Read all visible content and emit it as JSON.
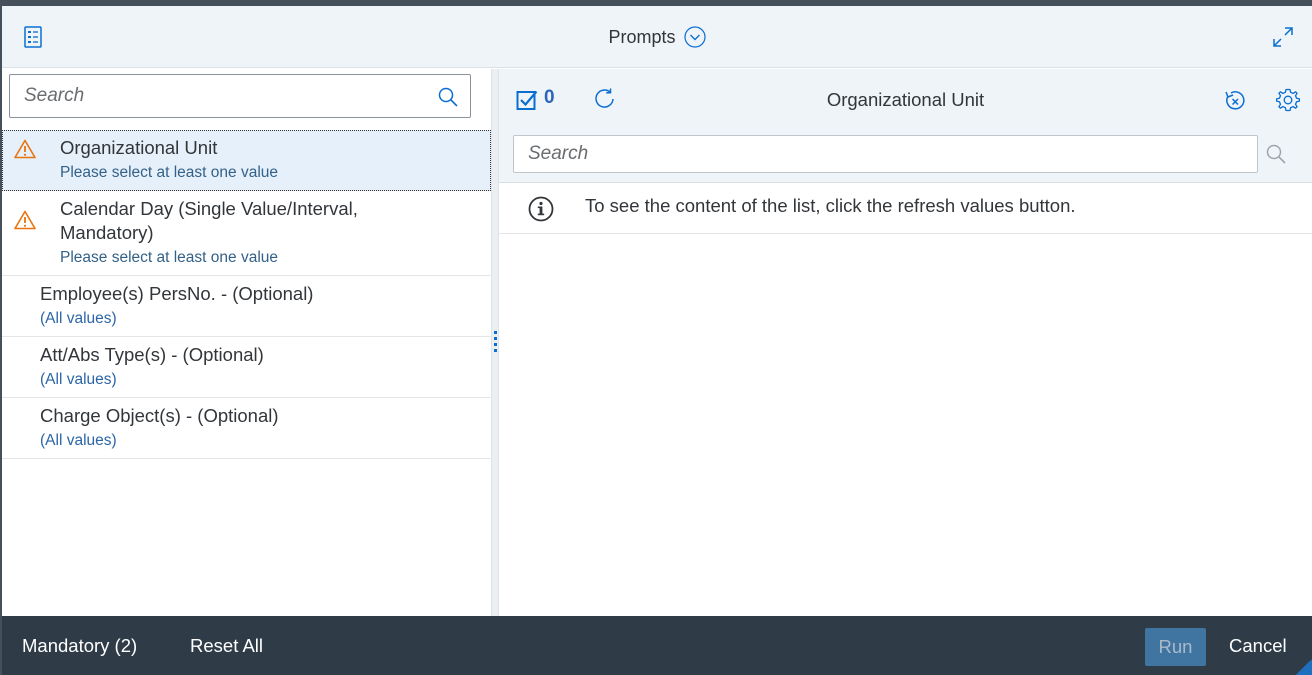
{
  "titlebar": {
    "title": "Prompts"
  },
  "left": {
    "search_placeholder": "Search",
    "prompts": [
      {
        "title": "Organizational Unit",
        "sub": "Please select at least one value",
        "warning": true,
        "selected": true
      },
      {
        "title": "Calendar Day (Single Value/Interval,",
        "title2": "Mandatory)",
        "sub": "Please select at least one value",
        "warning": true
      },
      {
        "title": "Employee(s) PersNo. - (Optional)",
        "sub": "(All values)",
        "warning": false
      },
      {
        "title": "Att/Abs Type(s) - (Optional)",
        "sub": "(All values)",
        "warning": false
      },
      {
        "title": "Charge Object(s) - (Optional)",
        "sub": "(All values)",
        "warning": false
      }
    ]
  },
  "right": {
    "selected_count": "0",
    "title": "Organizational Unit",
    "search_placeholder": "Search",
    "info_text": "To see the content of the list, click the refresh values button."
  },
  "footer": {
    "mandatory": "Mandatory (2)",
    "reset_all": "Reset All",
    "run": "Run",
    "cancel": "Cancel"
  },
  "colors": {
    "accent": "#0a6ed1",
    "warning": "#e9730c",
    "footer_bg": "#2f3c48",
    "header_bg": "#eff4f9"
  }
}
